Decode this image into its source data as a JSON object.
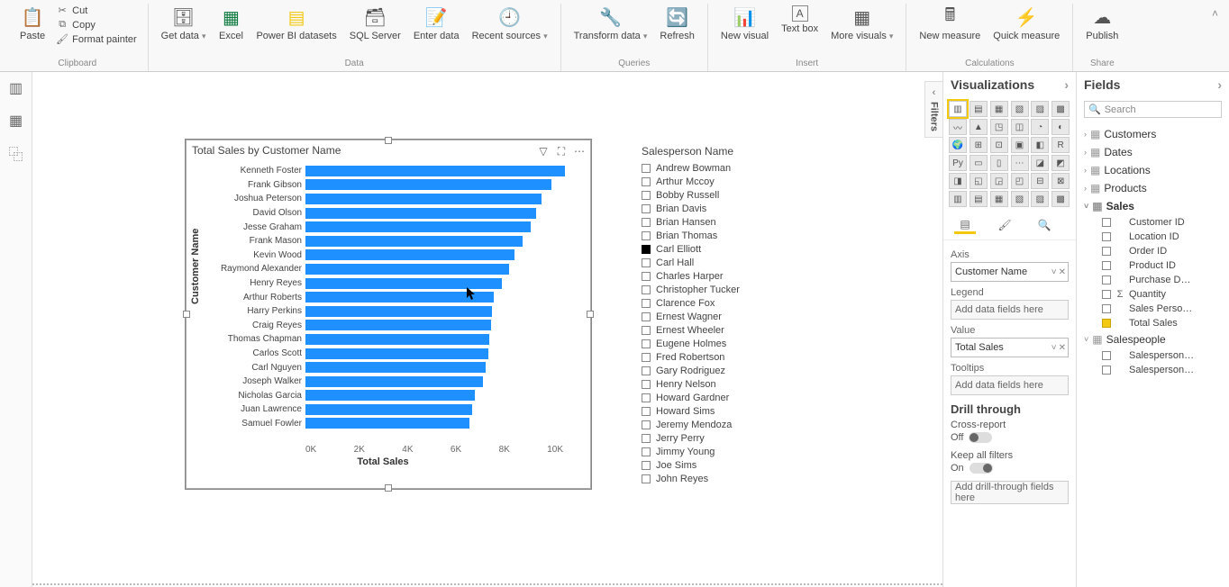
{
  "ribbon": {
    "clipboard": {
      "paste": "Paste",
      "cut": "Cut",
      "copy": "Copy",
      "fmt": "Format painter",
      "label": "Clipboard"
    },
    "data": {
      "get": "Get data",
      "excel": "Excel",
      "pbids": "Power BI datasets",
      "sql": "SQL Server",
      "enter": "Enter data",
      "recent": "Recent sources",
      "label": "Data"
    },
    "queries": {
      "transform": "Transform data",
      "refresh": "Refresh",
      "label": "Queries"
    },
    "insert": {
      "newvis": "New visual",
      "textbox": "Text box",
      "more": "More visuals",
      "label": "Insert"
    },
    "calc": {
      "newmeasure": "New measure",
      "quick": "Quick measure",
      "label": "Calculations"
    },
    "share": {
      "publish": "Publish",
      "label": "Share"
    }
  },
  "chart_data": {
    "type": "bar",
    "title": "Total Sales by Customer Name",
    "xlabel": "Total Sales",
    "ylabel": "Customer Name",
    "xlim": [
      0,
      10000
    ],
    "ticks": [
      "0K",
      "2K",
      "4K",
      "6K",
      "8K",
      "10K"
    ],
    "categories": [
      "Kenneth Foster",
      "Frank Gibson",
      "Joshua Peterson",
      "David Olson",
      "Jesse Graham",
      "Frank Mason",
      "Kevin Wood",
      "Raymond Alexander",
      "Henry Reyes",
      "Arthur Roberts",
      "Harry Perkins",
      "Craig Reyes",
      "Thomas Chapman",
      "Carlos Scott",
      "Carl Nguyen",
      "Joseph Walker",
      "Nicholas Garcia",
      "Juan Lawrence",
      "Samuel Fowler"
    ],
    "values": [
      9800,
      9300,
      8900,
      8700,
      8500,
      8200,
      7900,
      7700,
      7400,
      7100,
      7050,
      7000,
      6950,
      6900,
      6800,
      6700,
      6400,
      6300,
      6200
    ]
  },
  "slicer": {
    "title": "Salesperson Name",
    "items": [
      {
        "name": "Andrew Bowman",
        "checked": false
      },
      {
        "name": "Arthur Mccoy",
        "checked": false
      },
      {
        "name": "Bobby Russell",
        "checked": false
      },
      {
        "name": "Brian Davis",
        "checked": false
      },
      {
        "name": "Brian Hansen",
        "checked": false
      },
      {
        "name": "Brian Thomas",
        "checked": false
      },
      {
        "name": "Carl Elliott",
        "checked": true
      },
      {
        "name": "Carl Hall",
        "checked": false
      },
      {
        "name": "Charles Harper",
        "checked": false
      },
      {
        "name": "Christopher Tucker",
        "checked": false
      },
      {
        "name": "Clarence Fox",
        "checked": false
      },
      {
        "name": "Ernest Wagner",
        "checked": false
      },
      {
        "name": "Ernest Wheeler",
        "checked": false
      },
      {
        "name": "Eugene Holmes",
        "checked": false
      },
      {
        "name": "Fred Robertson",
        "checked": false
      },
      {
        "name": "Gary Rodriguez",
        "checked": false
      },
      {
        "name": "Henry Nelson",
        "checked": false
      },
      {
        "name": "Howard Gardner",
        "checked": false
      },
      {
        "name": "Howard Sims",
        "checked": false
      },
      {
        "name": "Jeremy Mendoza",
        "checked": false
      },
      {
        "name": "Jerry Perry",
        "checked": false
      },
      {
        "name": "Jimmy Young",
        "checked": false
      },
      {
        "name": "Joe Sims",
        "checked": false
      },
      {
        "name": "John Reyes",
        "checked": false
      }
    ]
  },
  "viz": {
    "title": "Visualizations",
    "axis_label": "Axis",
    "axis_value": "Customer Name",
    "legend_label": "Legend",
    "legend_placeholder": "Add data fields here",
    "value_label": "Value",
    "value_value": "Total Sales",
    "tooltips_label": "Tooltips",
    "tooltips_placeholder": "Add data fields here",
    "drill_title": "Drill through",
    "crossreport": "Cross-report",
    "off": "Off",
    "keepfilters": "Keep all filters",
    "on": "On",
    "drill_placeholder": "Add drill-through fields here"
  },
  "fields": {
    "title": "Fields",
    "search_placeholder": "Search",
    "tables": [
      {
        "name": "Customers",
        "expanded": false,
        "fields": []
      },
      {
        "name": "Dates",
        "expanded": false,
        "fields": []
      },
      {
        "name": "Locations",
        "expanded": false,
        "fields": []
      },
      {
        "name": "Products",
        "expanded": false,
        "fields": []
      },
      {
        "name": "Sales",
        "expanded": true,
        "bold": true,
        "fields": [
          {
            "name": "Customer ID",
            "checked": false,
            "sigma": false
          },
          {
            "name": "Location ID",
            "checked": false,
            "sigma": false
          },
          {
            "name": "Order ID",
            "checked": false,
            "sigma": false
          },
          {
            "name": "Product ID",
            "checked": false,
            "sigma": false
          },
          {
            "name": "Purchase D…",
            "checked": false,
            "sigma": false
          },
          {
            "name": "Quantity",
            "checked": false,
            "sigma": true
          },
          {
            "name": "Sales Perso…",
            "checked": false,
            "sigma": false
          },
          {
            "name": "Total Sales",
            "checked": true,
            "sigma": false
          }
        ]
      },
      {
        "name": "Salespeople",
        "expanded": true,
        "fields": [
          {
            "name": "Salesperson…",
            "checked": false,
            "sigma": false
          },
          {
            "name": "Salesperson…",
            "checked": false,
            "sigma": false
          }
        ]
      }
    ]
  },
  "filters_tab": "Filters"
}
